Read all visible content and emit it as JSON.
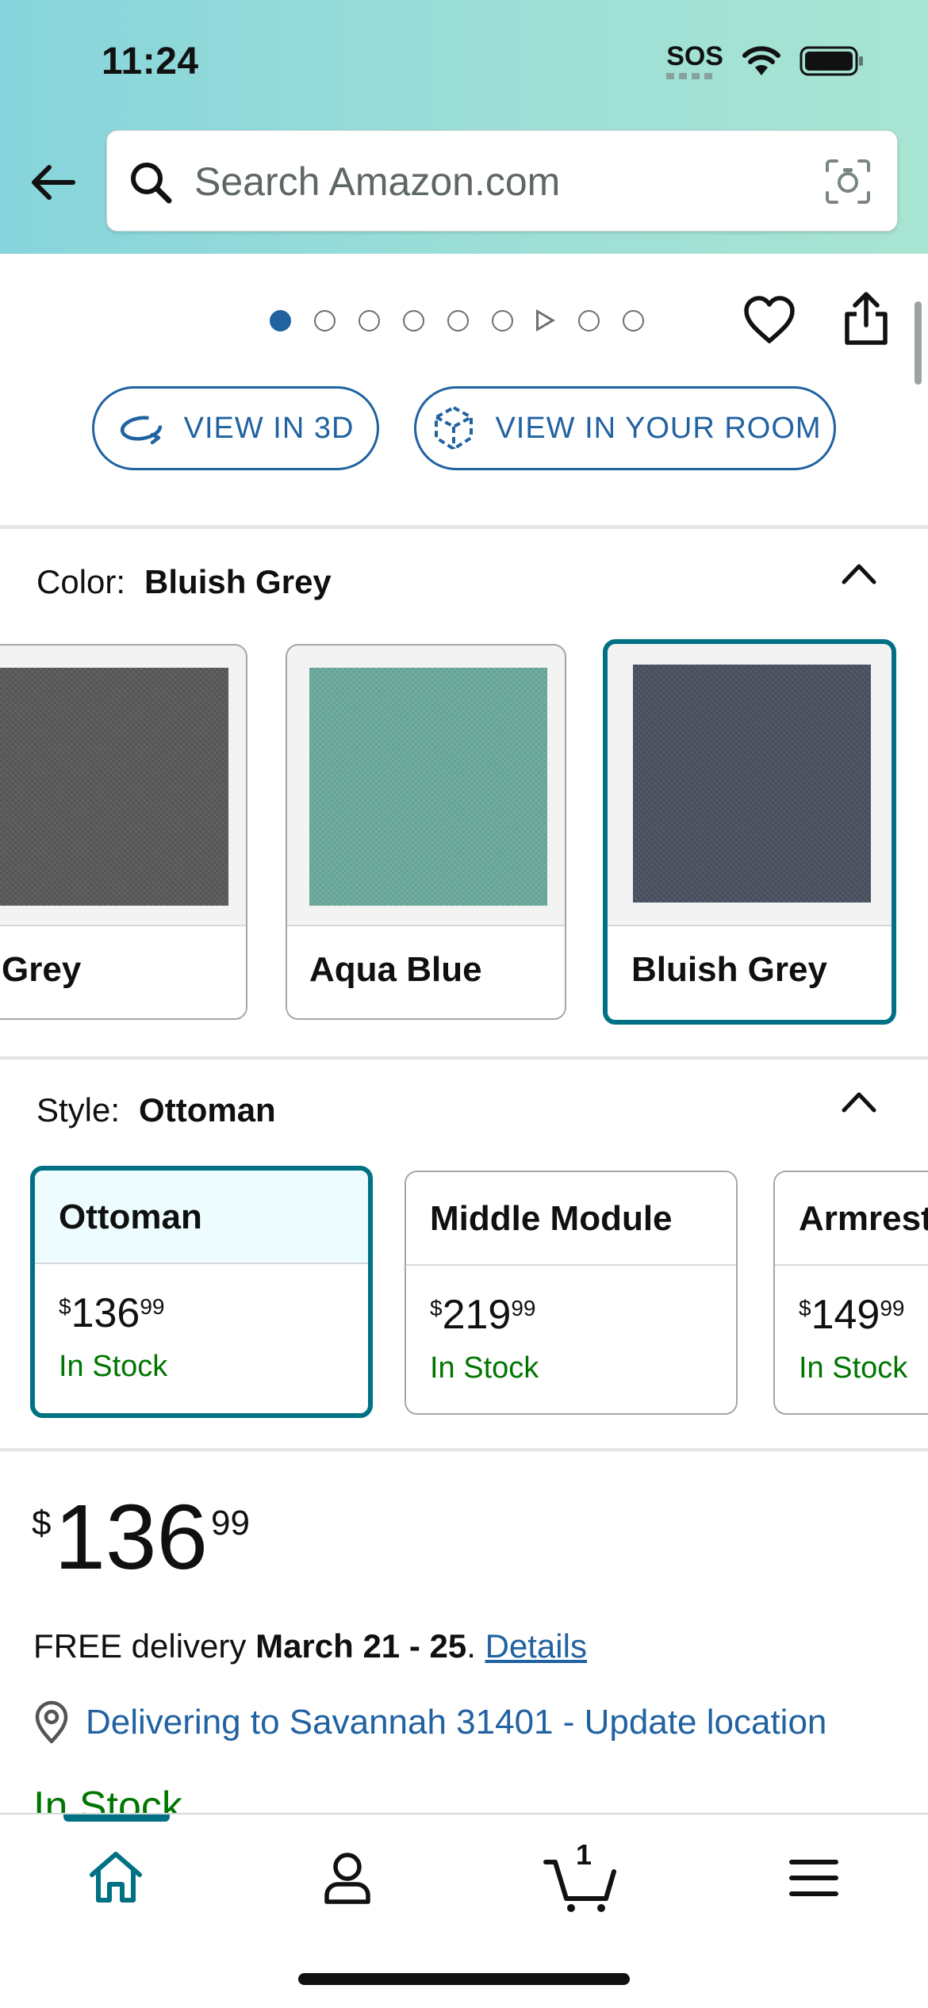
{
  "status_bar": {
    "time": "11:24",
    "sos": "SOS"
  },
  "search": {
    "placeholder": "Search Amazon.com"
  },
  "media_controls": {
    "view_3d_label": "VIEW IN 3D",
    "view_room_label": "VIEW IN YOUR ROOM"
  },
  "color_section": {
    "label": "Color:",
    "selected": "Bluish Grey",
    "options": [
      {
        "name": "Grey",
        "color": "#5a5a5b",
        "selected": false
      },
      {
        "name": "Aqua Blue",
        "color": "#6aa99c",
        "selected": false
      },
      {
        "name": "Bluish Grey",
        "color": "#4c5262",
        "selected": true
      }
    ]
  },
  "style_section": {
    "label": "Style:",
    "selected": "Ottoman",
    "options": [
      {
        "name": "Ottoman",
        "currency": "$",
        "whole": "136",
        "cents": "99",
        "stock": "In Stock",
        "selected": true
      },
      {
        "name": "Middle Module",
        "currency": "$",
        "whole": "219",
        "cents": "99",
        "stock": "In Stock",
        "selected": false
      },
      {
        "name": "Armrest",
        "currency": "$",
        "whole": "149",
        "cents": "99",
        "stock": "In Stock",
        "selected": false
      }
    ]
  },
  "price": {
    "currency": "$",
    "whole": "136",
    "cents": "99"
  },
  "delivery": {
    "prefix": "FREE delivery",
    "dates": "March 21 - 25",
    "suffix": ".",
    "details_link": "Details"
  },
  "location": {
    "text": "Delivering to Savannah 31401 - Update location"
  },
  "availability": "In Stock",
  "bottom_nav": {
    "cart_count": "1"
  },
  "colors": {
    "accent_teal": "#007185",
    "link_blue": "#2162a1",
    "stock_green": "#007600"
  }
}
